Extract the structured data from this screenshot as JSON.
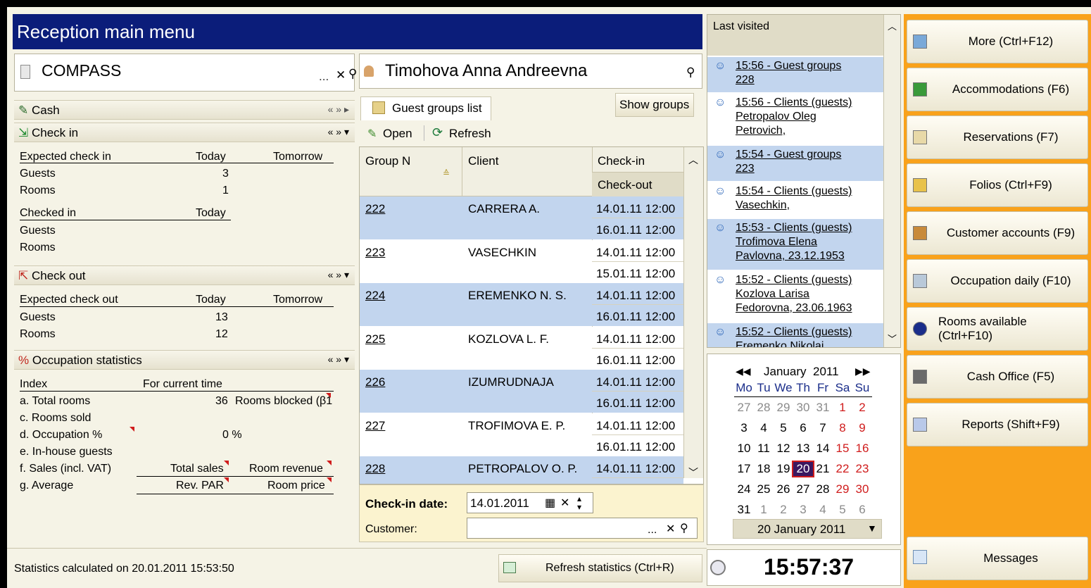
{
  "title": "Reception main menu",
  "org": {
    "name": "COMPASS"
  },
  "guest": {
    "name": "Timohova Anna Andreevna"
  },
  "cash": {
    "label": "Cash"
  },
  "checkin": {
    "label": "Check in",
    "expected_label": "Expected check in",
    "today": "Today",
    "tomorrow": "Tomorrow",
    "guests_label": "Guests",
    "guests_today": "3",
    "rooms_label": "Rooms",
    "rooms_today": "1",
    "checked_in_label": "Checked in",
    "checked_today": "Today",
    "checked_guests": "Guests",
    "checked_rooms": "Rooms"
  },
  "checkout": {
    "label": "Check out",
    "expected_label": "Expected check out",
    "today": "Today",
    "tomorrow": "Tomorrow",
    "guests_label": "Guests",
    "guests_today": "13",
    "rooms_label": "Rooms",
    "rooms_today": "12"
  },
  "occupation": {
    "label": "Occupation statistics",
    "index": "Index",
    "for_current_time": "For current time",
    "a": "a. Total rooms",
    "a_val": "36",
    "a_blocked": "Rooms blocked (β1",
    "c": "c. Rooms sold",
    "d": "d. Occupation %",
    "d_val": "0 %",
    "e": "e. In-house guests",
    "f": "f. Sales (incl. VAT)",
    "f_total": "Total sales",
    "f_room": "Room revenue",
    "g": "g. Average",
    "g_rev": "Rev. PAR",
    "g_price": "Room price"
  },
  "groups": {
    "tab": "Guest groups list",
    "show_groups": "Show groups",
    "open": "Open",
    "refresh": "Refresh",
    "col_group": "Group N",
    "col_client": "Client",
    "col_checkin": "Check-in",
    "col_checkout": "Check-out",
    "rows": [
      {
        "n": "222",
        "client": "CARRERA A.",
        "in": "14.01.11 12:00",
        "out": "16.01.11 12:00"
      },
      {
        "n": "223",
        "client": "VASECHKIN",
        "in": "14.01.11 12:00",
        "out": "15.01.11 12:00"
      },
      {
        "n": "224",
        "client": "EREMENKO N. S.",
        "in": "14.01.11 12:00",
        "out": "16.01.11 12:00"
      },
      {
        "n": "225",
        "client": "KOZLOVA L. F.",
        "in": "14.01.11 12:00",
        "out": "16.01.11 12:00"
      },
      {
        "n": "226",
        "client": "IZUMRUDNAJA",
        "in": "14.01.11 12:00",
        "out": "16.01.11 12:00"
      },
      {
        "n": "227",
        "client": "TROFIMOVA E. P.",
        "in": "14.01.11 12:00",
        "out": "16.01.11 12:00"
      },
      {
        "n": "228",
        "client": "PETROPALOV O. P.",
        "in": "14.01.11 12:00",
        "out": ""
      }
    ],
    "checkin_date_label": "Check-in date:",
    "checkin_date": "14.01.2011",
    "customer_label": "Customer:"
  },
  "last_visited": {
    "title": "Last visited",
    "items": [
      {
        "l1": "15:56 - Guest groups",
        "l2": "228",
        "l3": ""
      },
      {
        "l1": "15:56 - Clients (guests)",
        "l2": "Petropalov Oleg",
        "l3": "Petrovich,"
      },
      {
        "l1": "15:54 - Guest groups",
        "l2": "223",
        "l3": ""
      },
      {
        "l1": "15:54 - Clients (guests)",
        "l2": "Vasechkin,",
        "l3": ""
      },
      {
        "l1": "15:53 - Clients (guests)",
        "l2": "Trofimova Elena",
        "l3": "Pavlovna, 23.12.1953"
      },
      {
        "l1": "15:52 - Clients (guests)",
        "l2": "Kozlova Larisa",
        "l3": "Fedorovna, 23.06.1963"
      },
      {
        "l1": "15:52 - Clients (guests)",
        "l2": "Eremenko Nikolai",
        "l3": ""
      }
    ]
  },
  "calendar": {
    "month": "January",
    "year": "2011",
    "weekdays": [
      "Mo",
      "Tu",
      "We",
      "Th",
      "Fr",
      "Sa",
      "Su"
    ],
    "weeks": [
      [
        "27",
        "28",
        "29",
        "30",
        "31",
        "1",
        "2"
      ],
      [
        "3",
        "4",
        "5",
        "6",
        "7",
        "8",
        "9"
      ],
      [
        "10",
        "11",
        "12",
        "13",
        "14",
        "15",
        "16"
      ],
      [
        "17",
        "18",
        "19",
        "20",
        "21",
        "22",
        "23"
      ],
      [
        "24",
        "25",
        "26",
        "27",
        "28",
        "29",
        "30"
      ],
      [
        "31",
        "1",
        "2",
        "3",
        "4",
        "5",
        "6"
      ]
    ],
    "selected": "20 January 2011"
  },
  "clock": "15:57:37",
  "status": "Statistics calculated on 20.01.2011 15:53:50",
  "refresh_stats": "Refresh statistics (Ctrl+R)",
  "nav": [
    {
      "label": "More (Ctrl+F12)",
      "icon": "arrow-left-icon"
    },
    {
      "label": "Accommodations (F6)",
      "icon": "accommodation-icon"
    },
    {
      "label": "Reservations (F7)",
      "icon": "reservation-icon"
    },
    {
      "label": "Folios (Ctrl+F9)",
      "icon": "folio-icon"
    },
    {
      "label": "Customer accounts (F9)",
      "icon": "customer-account-icon"
    },
    {
      "label": "Occupation daily (F10)",
      "icon": "occupation-icon"
    },
    {
      "label": "Rooms available (Ctrl+F10)",
      "icon": "info-icon"
    },
    {
      "label": "Cash Office (F5)",
      "icon": "cash-office-icon"
    },
    {
      "label": "Reports (Shift+F9)",
      "icon": "reports-icon"
    }
  ],
  "messages": {
    "label": "Messages"
  },
  "colors": {
    "title_bg": "#0b1d7a",
    "nav_bg": "#f9a21b",
    "row_highlight": "#c2d5ee",
    "weekend": "#d01c1c",
    "selected_day": "#3a1860"
  }
}
